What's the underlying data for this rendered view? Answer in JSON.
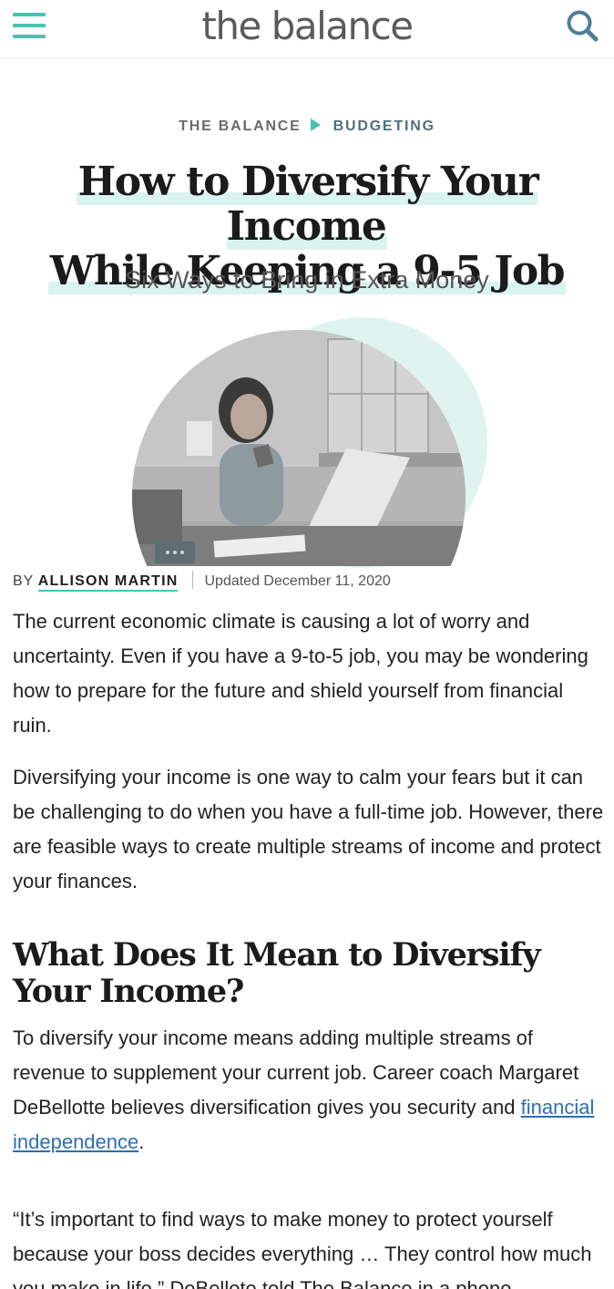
{
  "header": {
    "logo": "the balance",
    "menu_icon": "hamburger-menu-icon",
    "search_icon": "search-icon",
    "accent_color": "#48c3b0"
  },
  "breadcrumb": {
    "items": [
      "THE BALANCE",
      "BUDGETING"
    ]
  },
  "article": {
    "title_line1": "How to Diversify Your Income",
    "title_line2": "While Keeping a 9-5 Job",
    "subtitle": "Six Ways to Bring in Extra Money",
    "byline_prefix": "BY",
    "author": "ALLISON MARTIN",
    "updated": "Updated December 11, 2020",
    "paragraphs": [
      "The current economic climate is causing a lot of worry and uncertainty. Even if you have a 9-to-5 job, you may be wondering how to prepare for the future and shield yourself from financial ruin.",
      "Diversifying your income is one way to calm your fears but it can be challenging to do when you have a full-time job. However, there are feasible ways to create multiple streams of income and protect your finances."
    ],
    "section_heading": "What Does It Mean to Diversify Your Income?",
    "section_p1_text": "To diversify your income means adding multiple streams of revenue to supplement your current job. Career coach Margaret DeBellotte believes diversification gives you security and ",
    "section_p1_link": "financial independence",
    "section_p1_end": ".",
    "quote_text": "“It’s important to find ways to make money to protect yourself because your boss decides everything … They control how much you make in life,” DeBellote told The Balance in a phone"
  }
}
